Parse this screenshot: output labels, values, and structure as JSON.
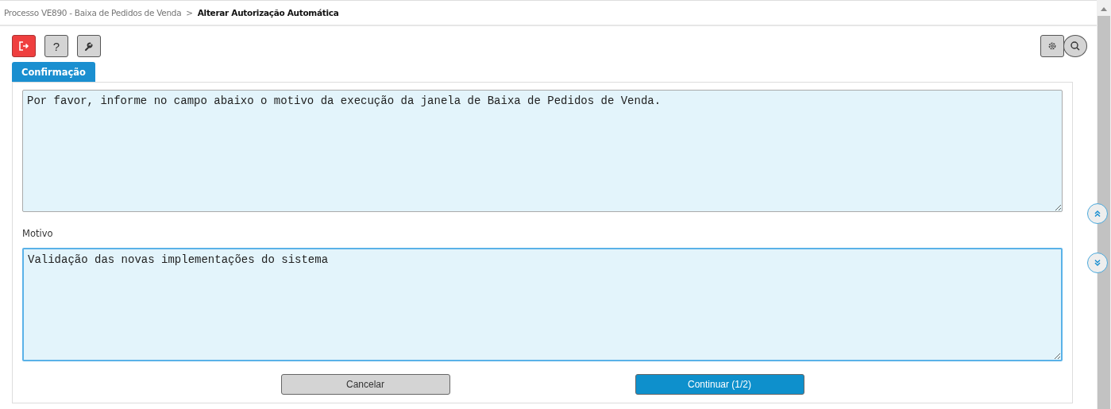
{
  "breadcrumb": [
    {
      "label": "Processo VE890 - Baixa de Pedidos de Venda",
      "current": false
    },
    {
      "separator": ">"
    },
    {
      "label": "Alterar Autorização Automática",
      "current": true
    }
  ],
  "toolbar": {
    "help_symbol": "?"
  },
  "tabs": [
    {
      "label": "Confirmação",
      "selected": true
    }
  ],
  "message": {
    "value": "Por favor, informe no campo abaixo o motivo da execução da janela de Baixa de Pedidos de Venda."
  },
  "reason": {
    "label": "Motivo",
    "value": "Validação das novas implementações do sistema",
    "focused": true
  },
  "buttons": [
    {
      "label": "Cancelar",
      "kind": "secondary"
    },
    {
      "label": "Continuar (1/2)",
      "kind": "primary"
    }
  ]
}
